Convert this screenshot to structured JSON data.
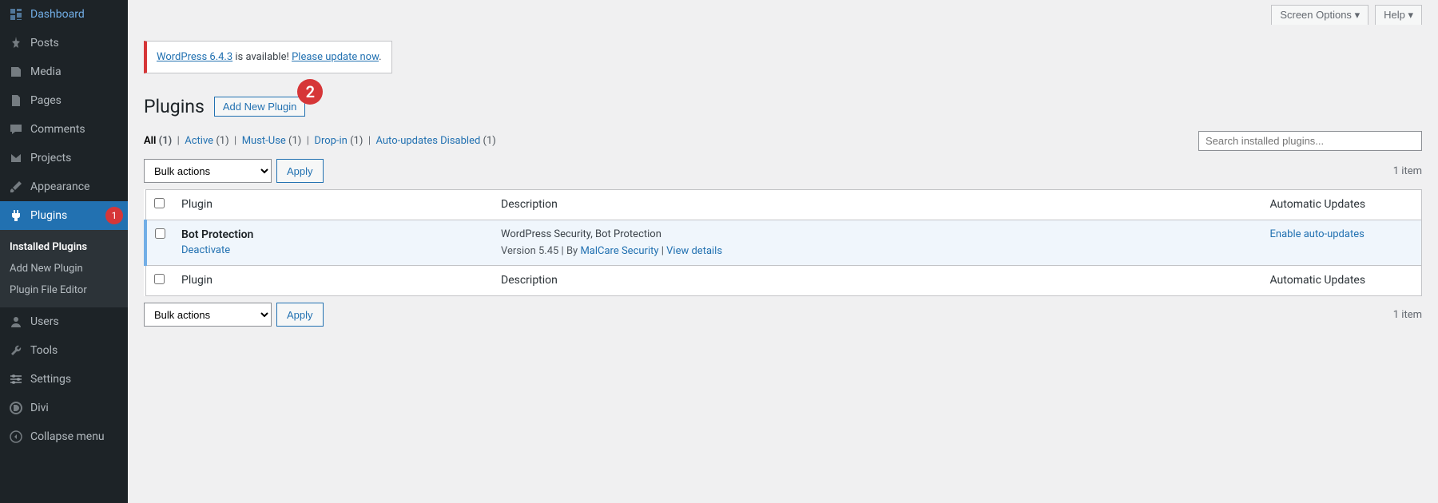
{
  "sidebar": {
    "items": [
      {
        "label": "Dashboard",
        "icon": "dashboard"
      },
      {
        "label": "Posts",
        "icon": "pin"
      },
      {
        "label": "Media",
        "icon": "media"
      },
      {
        "label": "Pages",
        "icon": "pages"
      },
      {
        "label": "Comments",
        "icon": "comment"
      },
      {
        "label": "Projects",
        "icon": "projects"
      },
      {
        "label": "Appearance",
        "icon": "brush"
      },
      {
        "label": "Plugins",
        "icon": "plug",
        "badge": "1"
      },
      {
        "label": "Users",
        "icon": "user"
      },
      {
        "label": "Tools",
        "icon": "tools"
      },
      {
        "label": "Settings",
        "icon": "settings"
      },
      {
        "label": "Divi",
        "icon": "divi"
      },
      {
        "label": "Collapse menu",
        "icon": "collapse"
      }
    ],
    "submenu": [
      {
        "label": "Installed Plugins"
      },
      {
        "label": "Add New Plugin"
      },
      {
        "label": "Plugin File Editor"
      }
    ]
  },
  "topbar": {
    "screen_options": "Screen Options",
    "help": "Help"
  },
  "notice": {
    "link1": "WordPress 6.4.3",
    "mid": " is available! ",
    "link2": "Please update now",
    "end": "."
  },
  "heading": {
    "title": "Plugins",
    "add_new": "Add New Plugin",
    "badge": "2"
  },
  "filters": {
    "all_label": "All",
    "all_count": "(1)",
    "active_label": "Active",
    "active_count": "(1)",
    "mustuse_label": "Must-Use",
    "mustuse_count": "(1)",
    "dropin_label": "Drop-in",
    "dropin_count": "(1)",
    "auto_label": "Auto-updates Disabled",
    "auto_count": "(1)"
  },
  "search": {
    "placeholder": "Search installed plugins..."
  },
  "bulk": {
    "default": "Bulk actions",
    "apply": "Apply"
  },
  "pagination": {
    "count": "1 item"
  },
  "table": {
    "col_plugin": "Plugin",
    "col_description": "Description",
    "col_auto": "Automatic Updates",
    "rows": [
      {
        "name": "Bot Protection",
        "action": "Deactivate",
        "description": "WordPress Security, Bot Protection",
        "version_pre": "Version 5.45 | By ",
        "author": "MalCare Security",
        "sep": " | ",
        "view": "View details",
        "auto_action": "Enable auto-updates"
      }
    ]
  }
}
